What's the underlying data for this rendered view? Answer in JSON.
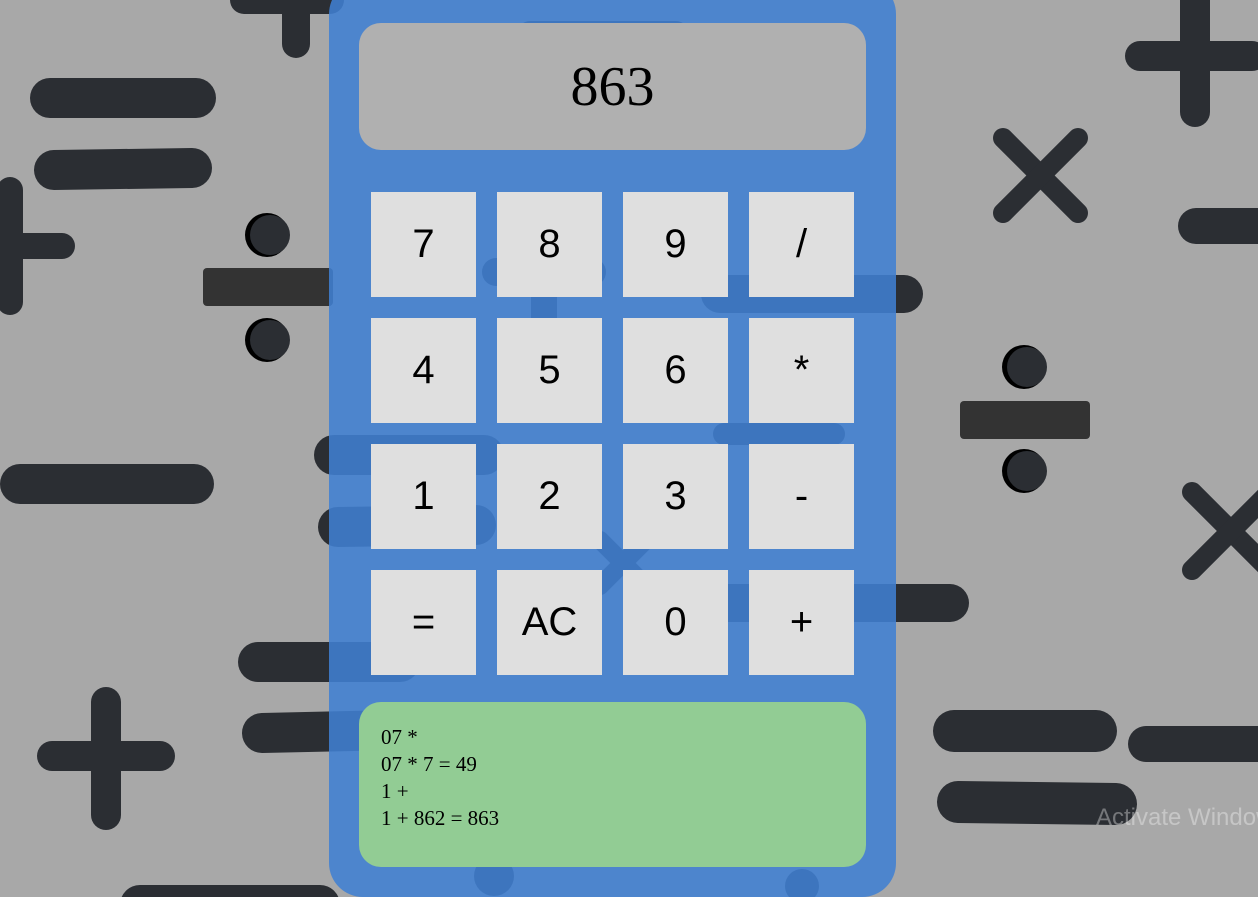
{
  "display": {
    "value": "863"
  },
  "keypad": {
    "keys": [
      {
        "label": "7",
        "name": "key-7"
      },
      {
        "label": "8",
        "name": "key-8"
      },
      {
        "label": "9",
        "name": "key-9"
      },
      {
        "label": "/",
        "name": "key-divide"
      },
      {
        "label": "4",
        "name": "key-4"
      },
      {
        "label": "5",
        "name": "key-5"
      },
      {
        "label": "6",
        "name": "key-6"
      },
      {
        "label": "*",
        "name": "key-multiply"
      },
      {
        "label": "1",
        "name": "key-1"
      },
      {
        "label": "2",
        "name": "key-2"
      },
      {
        "label": "3",
        "name": "key-3"
      },
      {
        "label": "-",
        "name": "key-subtract"
      },
      {
        "label": "=",
        "name": "key-equals"
      },
      {
        "label": "AC",
        "name": "key-clear"
      },
      {
        "label": "0",
        "name": "key-0"
      },
      {
        "label": "+",
        "name": "key-add"
      }
    ]
  },
  "history": {
    "lines": [
      "07 *",
      "07 * 7 = 49",
      "1 +",
      "1 + 862 = 863"
    ]
  },
  "watermark": {
    "text": "Activate Windows"
  },
  "colors": {
    "page_background": "#a8a8a8",
    "calculator_body": "#4a84c9",
    "display_background": "#b0b0b0",
    "key_background": "#dfdfdf",
    "history_background": "#92cc94",
    "background_symbols": "#2b2e33"
  },
  "background": {
    "symbols": [
      "plus-icon",
      "minus-icon",
      "equals-icon",
      "multiply-icon",
      "divide-icon"
    ]
  }
}
